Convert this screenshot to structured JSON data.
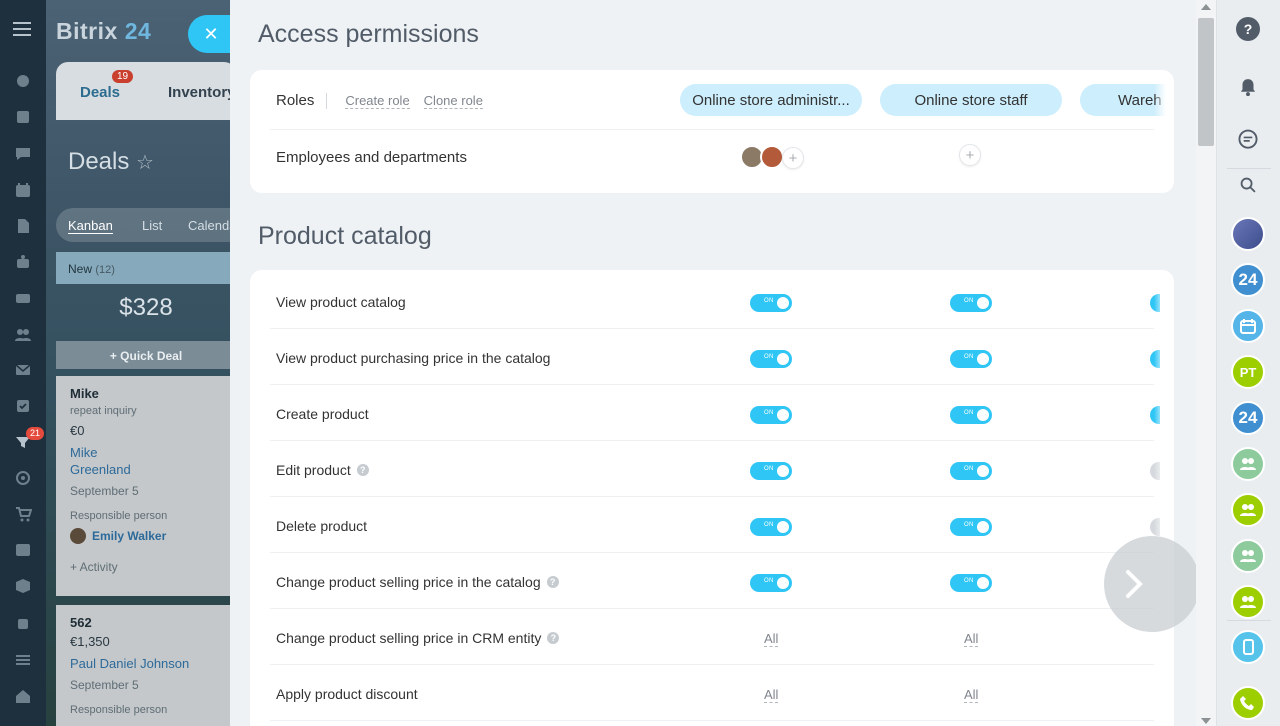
{
  "app": {
    "logo_text": "Bitrix",
    "logo_number": "24"
  },
  "left_nav": {
    "funnel_badge": "21"
  },
  "background_app": {
    "tabs": {
      "deals_label": "Deals",
      "deals_badge": "19",
      "inventory_label": "Inventory"
    },
    "page_title": "Deals",
    "view_tabs": [
      "Kanban",
      "List",
      "Calendar"
    ],
    "stage": {
      "name": "New",
      "count": "(12)"
    },
    "stage_amount": "$328",
    "quick_deal": "+ Quick Deal",
    "cards": [
      {
        "title": "Mike",
        "subtitle": "repeat inquiry",
        "sum": "€0",
        "contact": "Mike Greenland",
        "date": "September 5",
        "responsible_label": "Responsible person",
        "responsible": "Emily Walker",
        "activity": "+ Activity"
      },
      {
        "title": "562",
        "sum": "€1,350",
        "contact": "Paul Daniel Johnson",
        "date": "September 5",
        "responsible_label": "Responsible person"
      }
    ]
  },
  "slider": {
    "title": "Access permissions",
    "roles": {
      "label": "Roles",
      "create_role": "Create role",
      "clone_role": "Clone role",
      "role_names": [
        "Online store administr...",
        "Online store staff",
        "Wareh"
      ],
      "employees_label": "Employees and departments"
    },
    "catalog": {
      "title": "Product catalog",
      "all_label": "All",
      "toggle_label": "ON",
      "permissions": [
        {
          "label": "View product catalog",
          "help": false,
          "type": "toggle"
        },
        {
          "label": "View product purchasing price in the catalog",
          "help": false,
          "type": "toggle"
        },
        {
          "label": "Create product",
          "help": false,
          "type": "toggle"
        },
        {
          "label": "Edit product",
          "help": true,
          "type": "toggle"
        },
        {
          "label": "Delete product",
          "help": false,
          "type": "toggle"
        },
        {
          "label": "Change product selling price in the catalog",
          "help": true,
          "type": "toggle"
        },
        {
          "label": "Change product selling price in CRM entity",
          "help": true,
          "type": "all"
        },
        {
          "label": "Apply product discount",
          "help": false,
          "type": "all"
        }
      ]
    }
  },
  "right_sidebar": {
    "initials": "PT"
  },
  "colors": {
    "accent": "#2fc6f6",
    "role_pill": "#cdeefc",
    "green": "#9dcf00",
    "blue_badge": "#3f8fd1"
  }
}
